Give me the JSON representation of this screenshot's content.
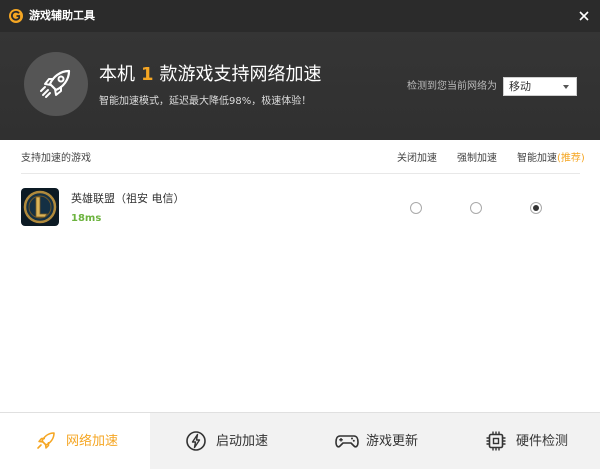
{
  "app": {
    "title": "游戏辅助工具"
  },
  "banner": {
    "headline_prefix": "本机",
    "headline_count": "1",
    "headline_suffix": "款游戏支持网络加速",
    "subline": "智能加速模式，延迟最大降低98%，极速体验！",
    "network_label": "检测到您当前网络为",
    "network_value": "移动"
  },
  "table": {
    "header_game": "支持加速的游戏",
    "header_off": "关闭加速",
    "header_force": "强制加速",
    "header_smart": "智能加速",
    "header_smart_tag": "(推荐)",
    "rows": [
      {
        "name": "英雄联盟（祖安 电信）",
        "ping": "18ms",
        "mode": "smart"
      }
    ]
  },
  "nav": [
    {
      "label": "网络加速",
      "active": true
    },
    {
      "label": "启动加速",
      "active": false
    },
    {
      "label": "游戏更新",
      "active": false
    },
    {
      "label": "硬件检测",
      "active": false
    }
  ],
  "colors": {
    "accent": "#f5a623",
    "ping": "#6cb33e",
    "titlebar": "#2b2b2b",
    "banner": "#333333"
  }
}
